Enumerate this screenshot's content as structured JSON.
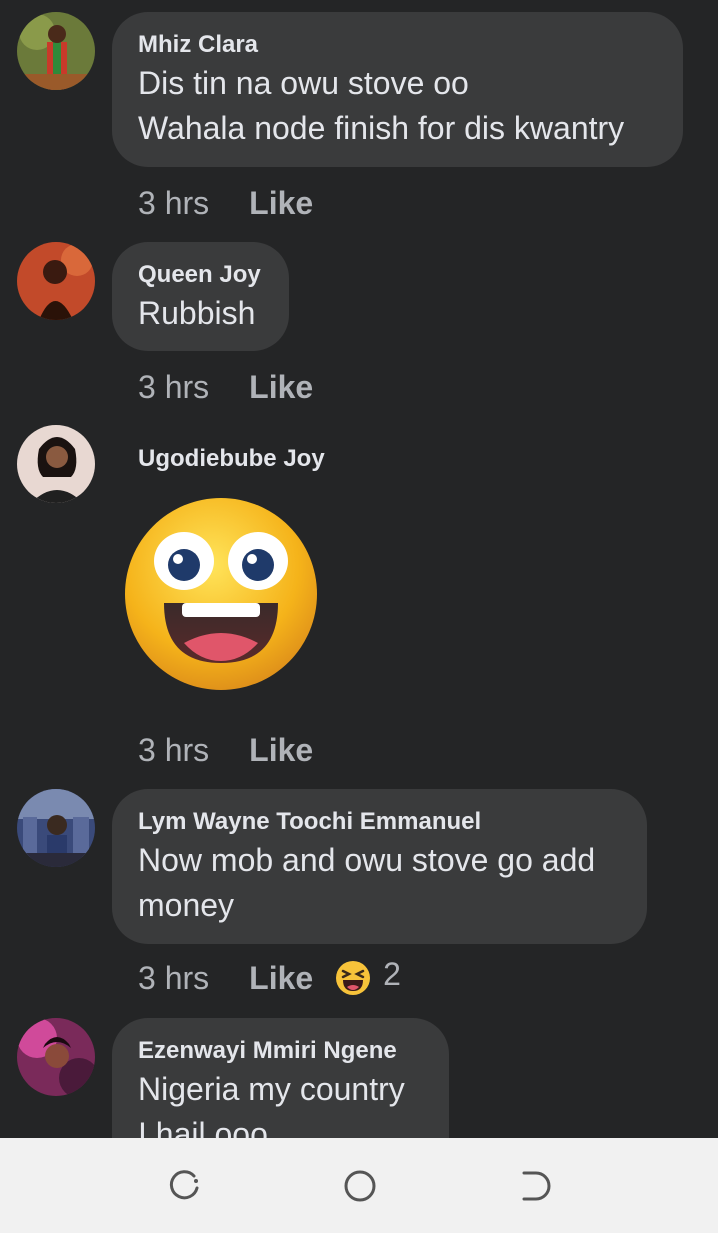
{
  "comments": [
    {
      "author": "Mhiz Clara",
      "text": "Dis tin na owu stove oo\nWahala node finish for dis kwantry",
      "time": "3 hrs",
      "like": "Like"
    },
    {
      "author": "Queen Joy",
      "text": "Rubbish",
      "time": "3 hrs",
      "like": "Like"
    },
    {
      "author": "Ugodiebube Joy",
      "sticker": "grinning-face-sticker",
      "time": "3 hrs",
      "like": "Like"
    },
    {
      "author": "Lym Wayne Toochi Emmanuel",
      "text": "Now mob and owu stove go add\nmoney",
      "time": "3 hrs",
      "like": "Like",
      "reaction": {
        "icon": "haha-icon",
        "count": "2"
      }
    },
    {
      "author": "Ezenwayi Mmiri Ngene",
      "text": "Nigeria my country\nI hail ooo",
      "time": "",
      "like": ""
    }
  ],
  "navbar": {
    "icons": [
      "recent-apps-icon",
      "home-icon",
      "back-icon"
    ]
  },
  "colors": {
    "background": "#242526",
    "bubble": "#3a3b3c",
    "text": "#e4e6eb",
    "secondary": "#b0b3b8",
    "navbar": "#f1f1f1"
  }
}
